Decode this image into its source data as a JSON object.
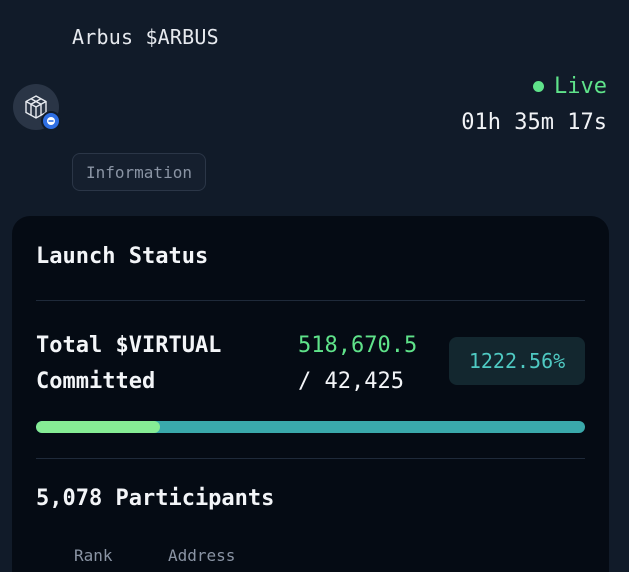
{
  "header": {
    "token_name": "Arbus $ARBUS",
    "status": "Live",
    "countdown": "01h 35m 17s",
    "info_button": "Information"
  },
  "launch_status": {
    "title": "Launch Status",
    "committed_label_line1": "Total $VIRTUAL",
    "committed_label_line2": "Committed",
    "committed_amount": "518,670.5",
    "committed_target": "/ 42,425",
    "percent": "1222.56%",
    "progress_fraction": 0.225,
    "participants": "5,078 Participants"
  },
  "table": {
    "columns": [
      "Rank",
      "Address"
    ]
  },
  "colors": {
    "live_green": "#5fe38a",
    "accent_teal": "#4fc9c2",
    "progress_green": "#86ec95",
    "progress_track": "#3aa9ab"
  }
}
